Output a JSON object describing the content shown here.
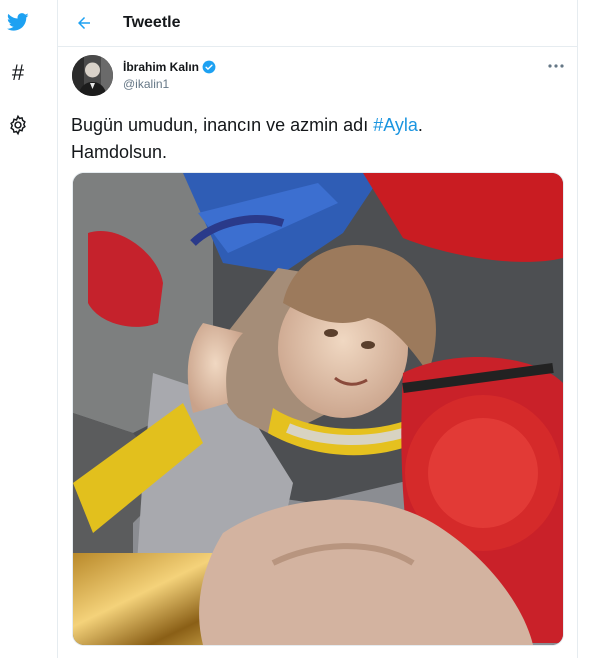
{
  "sidebar": {
    "icons": [
      "twitter-bird-icon",
      "hashtag-icon",
      "gear-icon"
    ],
    "hashtag_glyph": "#"
  },
  "header": {
    "back_icon": "arrow-left-icon",
    "title": "Tweetle"
  },
  "tweet": {
    "author_name": "İbrahim Kalın",
    "verified": true,
    "handle": "@ikalin1",
    "more_icon": "more-dots-icon",
    "text_before": "Bugün umudun, inancın ve azmin adı ",
    "hashtag": "#Ayla",
    "text_after": ".",
    "text_line2": "Hamdolsun.",
    "media": "photo of a rescued child on a stretcher"
  },
  "colors": {
    "accent": "#1da1f2",
    "hashtag": "#1b95e0",
    "border": "#e6ecf0",
    "secondary_text": "#657786"
  }
}
